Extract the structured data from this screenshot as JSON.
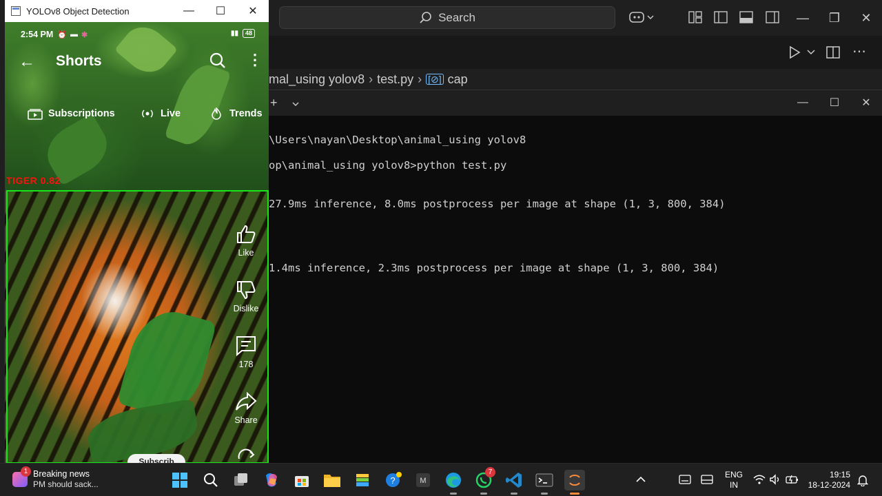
{
  "vscode": {
    "search_placeholder": "Search",
    "breadcrumb": {
      "folder": "mal_using yolov8",
      "file": "test.py",
      "symbol_glyph": "[⊘]",
      "symbol": "cap"
    },
    "terminal_lines": [
      "\\Users\\nayan\\Desktop\\animal_using yolov8",
      "op\\animal_using yolov8>python test.py",
      "27.9ms inference, 8.0ms postprocess per image at shape (1, 3, 800, 384)",
      "1.4ms inference, 2.3ms postprocess per image at shape (1, 3, 800, 384)"
    ]
  },
  "yolo_window": {
    "title": "YOLOv8 Object Detection",
    "detection_label": "TIGER 0.82",
    "box_color": "#19e619",
    "label_color": "#ff1010"
  },
  "phone": {
    "status_time": "2:54 PM",
    "battery": "48",
    "header_title": "Shorts",
    "chips": [
      "Subscriptions",
      "Live",
      "Trends"
    ],
    "actions": {
      "like": "Like",
      "dislike": "Dislike",
      "comments": "178",
      "share": "Share"
    },
    "subscribe_label": "Subscrib"
  },
  "taskbar": {
    "news_badge": "1",
    "news_title": "Breaking news",
    "news_subtitle": "PM should sack...",
    "whatsapp_badge": "7",
    "language": "ENG",
    "region": "IN",
    "time": "19:15",
    "date": "18-12-2024"
  }
}
